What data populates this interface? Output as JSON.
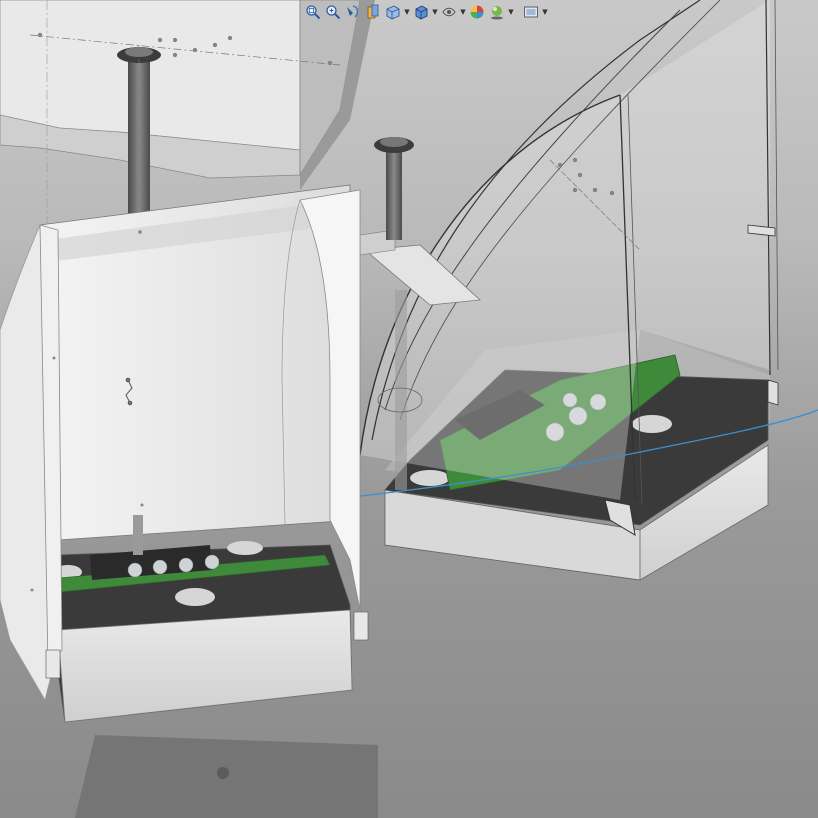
{
  "app": {
    "viewport_role": "3d-graphics-area"
  },
  "heads_up_toolbar": {
    "items": [
      {
        "icon": "zoom-to-fit-icon"
      },
      {
        "icon": "zoom-to-area-icon"
      },
      {
        "icon": "previous-view-icon"
      },
      {
        "icon": "section-view-icon"
      },
      {
        "icon": "view-orientation-icon",
        "dropdown": true
      },
      {
        "icon": "display-style-icon",
        "dropdown": true
      },
      {
        "icon": "hide-show-items-icon",
        "dropdown": true
      },
      {
        "icon": "edit-appearance-icon"
      },
      {
        "icon": "apply-scene-icon",
        "dropdown": true
      },
      {
        "icon": "view-settings-icon",
        "dropdown": true
      }
    ]
  },
  "colors": {
    "background_top": "#c9c9c9",
    "background_bottom": "#8a8a8a",
    "pcb_green": "#3f8a3a",
    "base_dark": "#3a3a3a",
    "base_light": "#e6e6e6",
    "triad_line": "#3b8fd0"
  }
}
